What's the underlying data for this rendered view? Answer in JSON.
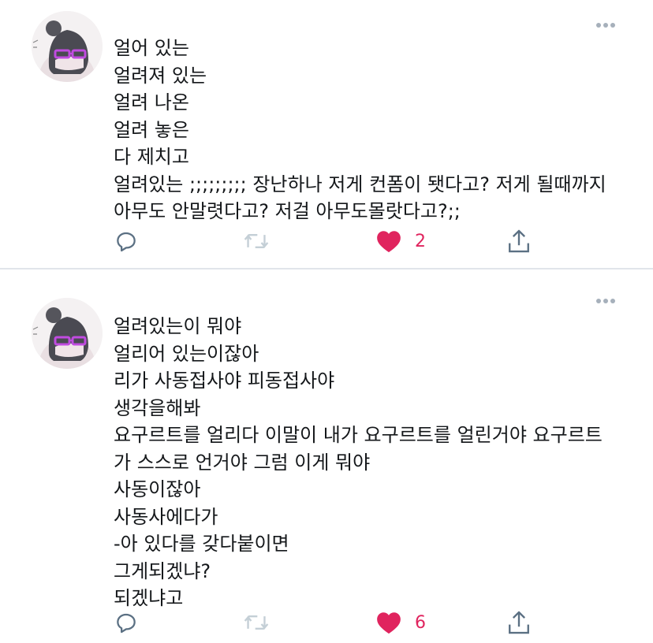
{
  "tweets": [
    {
      "lines": [
        "얼어 있는",
        "얼려져 있는",
        "얼려 나온",
        "얼려 놓은",
        "다 제치고",
        "얼려있는 ;;;;;;;;; 장난하나 저게 컨폼이 됏다고? 저게 될때까지",
        "아무도 안말렷다고? 저걸 아무도몰랏다고?;;"
      ],
      "likes": "2"
    },
    {
      "lines": [
        "얼려있는이 뭐야",
        "얼리어 있는이잖아",
        "리가 사동접사야 피동접사야",
        "생각을해봐",
        "요구르트를 얼리다 이말이 내가 요구르트를 얼린거야 요구르트",
        "가 스스로 언거야 그럼 이게 뭐야",
        "사동이잖아",
        "사동사에다가",
        "-아 있다를 갖다붙이면",
        "그게되겠냐?",
        "되겠냐고"
      ],
      "likes": "6"
    }
  ],
  "icons": {
    "reply": "reply-icon",
    "retweet": "retweet-icon",
    "like": "heart-icon",
    "share": "share-icon",
    "more": "more-options-icon"
  },
  "colors": {
    "like": "#e0245e",
    "icon": "#5b7083",
    "icon_muted": "#c4cfd6",
    "text": "#14171a",
    "divider": "#e1e5ea"
  }
}
